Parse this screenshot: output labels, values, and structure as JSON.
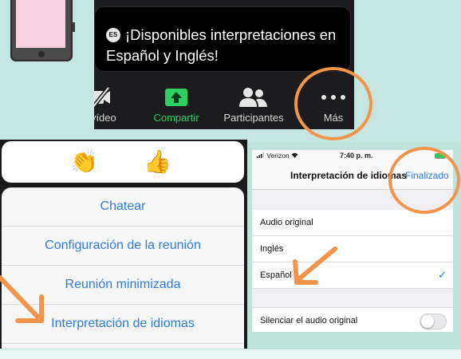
{
  "zoom": {
    "badge": "ES",
    "banner_text": "¡Disponibles interpretaciones en Español y Inglés!",
    "toolbar": {
      "video_label": "r vídeo",
      "share_label": "Compartir",
      "participants_label": "Participantes",
      "more_label": "Más"
    }
  },
  "reactions": {
    "clap": "👏",
    "thumbs_up": "👍"
  },
  "menu": {
    "items": [
      {
        "label": "Chatear"
      },
      {
        "label": "Configuración de la reunión"
      },
      {
        "label": "Reunión minimizada"
      },
      {
        "label": "Interpretación de idiomas"
      }
    ]
  },
  "ios": {
    "status": {
      "carrier": "Verizon",
      "time": "7:40 p. m."
    },
    "nav": {
      "title": "Interpretación de idiomas",
      "done": "Finalizado"
    },
    "options": [
      {
        "label": "Audio original",
        "selected": false
      },
      {
        "label": "Inglés",
        "selected": false
      },
      {
        "label": "Español",
        "selected": true
      }
    ],
    "mute_label": "Silenciar el audio original",
    "mute_on": false
  },
  "colors": {
    "background": "#c5e6e0",
    "accent_blue": "#2f7cd9",
    "share_green": "#2fd060",
    "annotation_orange": "#f2954a"
  }
}
